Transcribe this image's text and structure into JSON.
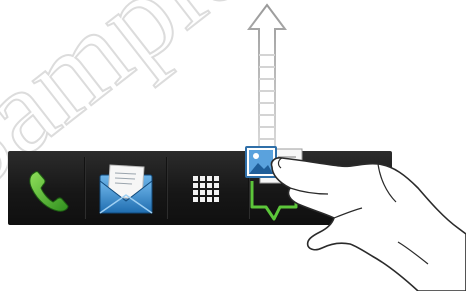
{
  "watermark": {
    "text": "Sample Publication"
  },
  "dock": {
    "items": [
      {
        "name": "Phone",
        "icon": "phone-icon"
      },
      {
        "name": "Mail",
        "icon": "mail-icon"
      },
      {
        "name": "All apps",
        "icon": "app-grid-icon"
      },
      {
        "name": "Gallery",
        "icon": "gallery-icon"
      },
      {
        "name": "Remove",
        "icon": "trash-icon"
      }
    ]
  },
  "gesture": {
    "direction": "up",
    "icon": "drag-up-arrow-icon"
  },
  "colors": {
    "dock_background": "#1b1b1b",
    "phone_green": "#4cae2e",
    "drag_outline": "#5cc63a",
    "mail_blue": "#3a8fd0"
  }
}
